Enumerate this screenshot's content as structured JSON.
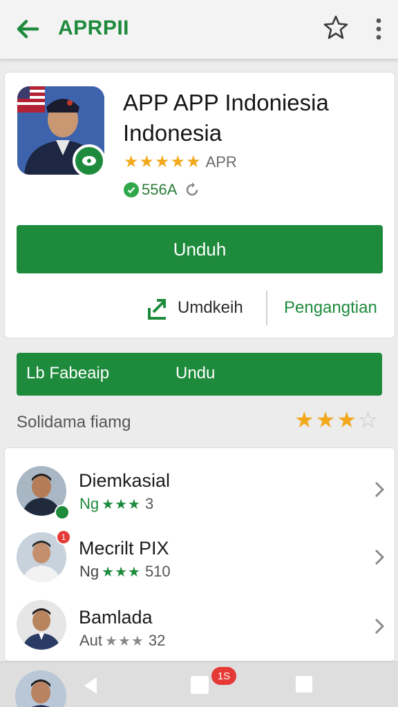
{
  "appbar": {
    "title": "APRPII",
    "back_icon": "arrow-left-icon",
    "favorite_icon": "star-outline-icon",
    "more_icon": "more-vertical-icon"
  },
  "app": {
    "name": "APP APP Indoniesia Indonesia",
    "rating_value": 5,
    "rating_label": "APR",
    "downloads_label": "556A",
    "install_label": "Unduh",
    "share_label": "Umdkeih",
    "settings_label": "Pengangtian"
  },
  "secondary_bar": {
    "left_label": "Lb Fabeaip",
    "right_label": "Undu"
  },
  "section": {
    "title": "Solidama fiamg",
    "rating_value": 3,
    "rating_max": 4
  },
  "list": [
    {
      "name": "Diemkasial",
      "prefix": "Ng",
      "stars": 3,
      "count": "3",
      "status": "online"
    },
    {
      "name": "Mecrilt PIX",
      "prefix": "Ng",
      "stars": 3,
      "count": "510",
      "notification": "1"
    },
    {
      "name": "Bamlada",
      "prefix": "Aut",
      "stars": 3,
      "count": "32"
    }
  ],
  "nav": {
    "badge": "1S"
  },
  "colors": {
    "primary": "#1e8a3c",
    "star": "#f2a81d",
    "badge": "#e53935"
  }
}
